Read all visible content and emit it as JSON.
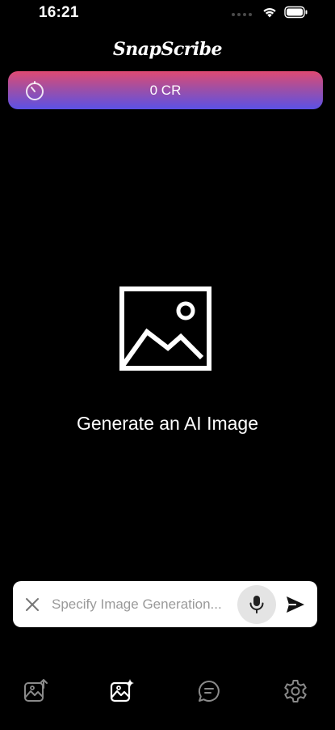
{
  "status_bar": {
    "time": "16:21"
  },
  "header": {
    "title": "SnapScribe"
  },
  "credits": {
    "value": "0 CR",
    "icon": "timer-icon"
  },
  "empty_state": {
    "icon": "image-placeholder-icon",
    "message": "Generate an AI Image"
  },
  "prompt": {
    "placeholder": "Specify Image Generation...",
    "value": "",
    "clear_icon": "close-icon",
    "mic_icon": "microphone-icon",
    "send_icon": "send-icon"
  },
  "tab_bar": {
    "tabs": [
      {
        "icon": "image-upload-icon",
        "active": false
      },
      {
        "icon": "image-sparkle-icon",
        "active": true
      },
      {
        "icon": "chat-bubble-icon",
        "active": false
      },
      {
        "icon": "gear-icon",
        "active": false
      }
    ]
  },
  "colors": {
    "background": "#000000",
    "gradient_top": "#e04a72",
    "gradient_bottom": "#5b51e6",
    "tab_active": "#ffffff",
    "tab_inactive": "#8a8a8a"
  }
}
